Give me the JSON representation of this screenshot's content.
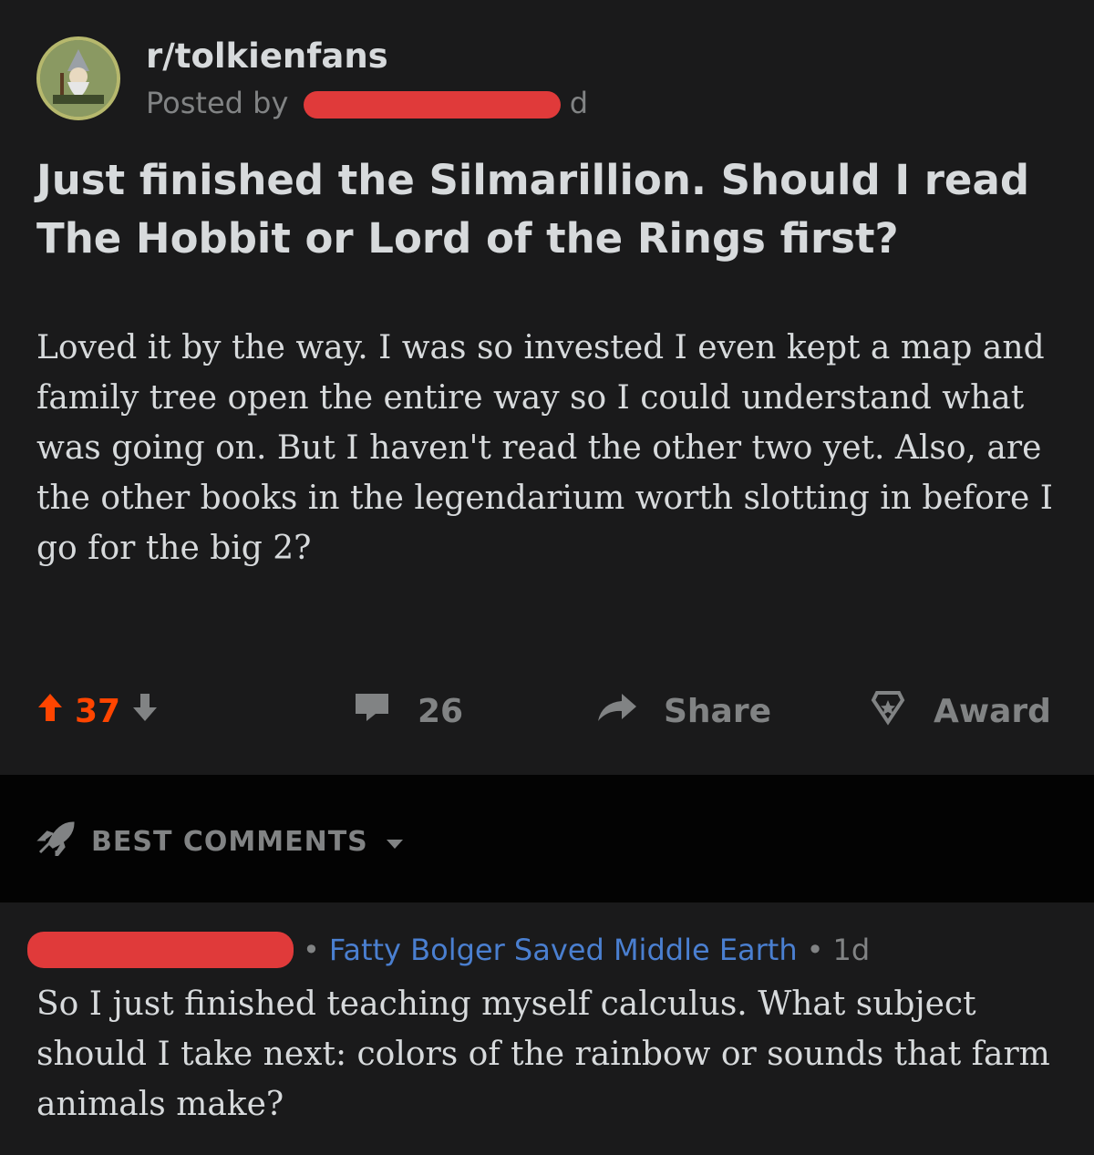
{
  "post": {
    "subreddit": "r/tolkienfans",
    "posted_by_label": "Posted by",
    "age_suffix": "d",
    "title": "Just finished the Silmarillion. Should I read The Hobbit or Lord of the Rings first?",
    "body": "Loved it by the way. I was so invested I even kept a map and family tree open the entire way so I could understand what was going on. But I haven't read the other two yet. Also, are the other books in the legendarium worth slotting in before I go for the big 2?",
    "upvotes": "37",
    "comments_count": "26",
    "share_label": "Share",
    "award_label": "Award"
  },
  "comments_section": {
    "sort_label": "BEST COMMENTS"
  },
  "comment": {
    "separator": "•",
    "flair": "Fatty Bolger Saved Middle Earth",
    "age": "1d",
    "body": "So I just finished teaching myself calculus. What subject should I take next: colors of the rainbow or sounds that farm animals make?"
  },
  "colors": {
    "background": "#1a1a1b",
    "band": "#030303",
    "upvote_accent": "#ff4500",
    "flair": "#4a7fd0",
    "redaction": "#e03a3a",
    "muted": "#818384"
  },
  "icons": [
    "subreddit-avatar-icon",
    "upvote-icon",
    "downvote-icon",
    "comment-icon",
    "share-icon",
    "award-icon",
    "rocket-icon",
    "caret-down-icon"
  ]
}
